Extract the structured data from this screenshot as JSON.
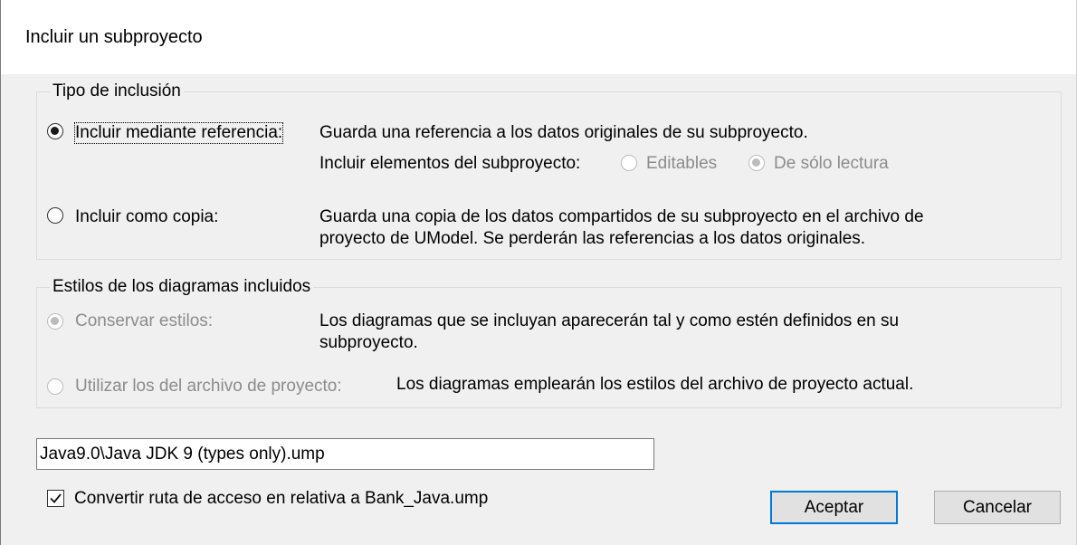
{
  "dialog": {
    "title": "Incluir un subproyecto"
  },
  "inclusion": {
    "legend": "Tipo de inclusión",
    "reference": {
      "label": "Incluir mediante referencia:",
      "selected": true,
      "description": "Guarda una referencia a los datos originales de su subproyecto.",
      "elements_label": "Incluir elementos del subproyecto:",
      "editable_label": "Editables",
      "readonly_label": "De sólo lectura",
      "readonly_selected": true
    },
    "copy": {
      "label": "Incluir como copia:",
      "selected": false,
      "description_line1": "Guarda una copia de los datos compartidos de su subproyecto en el archivo de",
      "description_line2": "proyecto de UModel. Se perderán las referencias a los datos originales."
    }
  },
  "styles": {
    "legend": "Estilos de los diagramas incluidos",
    "preserve": {
      "label": "Conservar estilos:",
      "selected": true,
      "description_line1": "Los diagramas que se incluyan aparecerán tal y como estén definidos en su",
      "description_line2": "subproyecto."
    },
    "project": {
      "label": "Utilizar los del archivo de proyecto:",
      "selected": false,
      "description": "Los diagramas emplearán los estilos del archivo de proyecto actual."
    }
  },
  "path_input": {
    "value": "Java9.0\\Java JDK 9 (types only).ump"
  },
  "relative_checkbox": {
    "label": "Convertir ruta de acceso en relativa a Bank_Java.ump",
    "checked": true
  },
  "buttons": {
    "ok": "Aceptar",
    "cancel": "Cancelar"
  },
  "colors": {
    "accent": "#0078d7",
    "disabled_text": "#8c8c8c",
    "background": "#f0f0f0"
  }
}
